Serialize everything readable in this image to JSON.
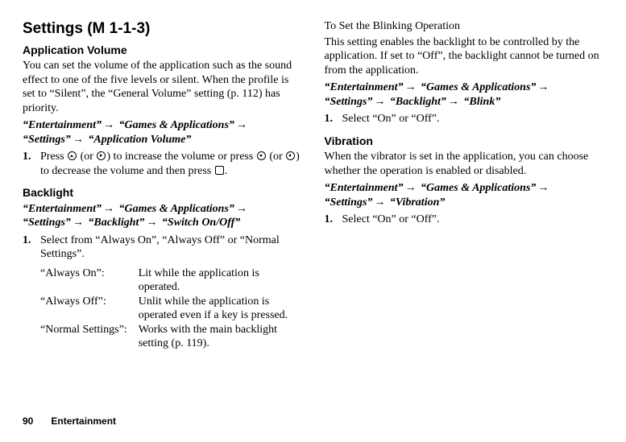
{
  "left": {
    "title": "Settings (M 1-1-3)",
    "appvol": {
      "heading": "Application Volume",
      "body": "You can set the volume of the application such as the sound effect to one of the five levels or silent. When the profile is set to “Silent”, the “General Volume” setting (p. 112) has priority.",
      "path": [
        "“Entertainment”",
        "“Games & Applications”",
        "“Settings”",
        "“Application Volume”"
      ],
      "step_num": "1.",
      "step_a": "Press ",
      "step_b": " (or ",
      "step_c": ") to increase the volume or press ",
      "step_d": " (or ",
      "step_e": ") to decrease the volume and then press ",
      "step_f": "."
    },
    "backlight": {
      "heading": "Backlight",
      "path": [
        "“Entertainment”",
        "“Games & Applications”",
        "“Settings”",
        "“Backlight”",
        "“Switch On/Off”"
      ],
      "step_num": "1.",
      "step_body": "Select from “Always On”, “Always Off” or “Normal Settings”.",
      "defs": [
        {
          "term": "“Always On”:",
          "desc": "Lit while the application is operated."
        },
        {
          "term": "“Always Off”:",
          "desc": "Unlit while the application is operated even if a key is pressed."
        },
        {
          "term": "“Normal Settings”:",
          "desc": "Works with the main backlight setting (p. 119)."
        }
      ]
    }
  },
  "right": {
    "blinking": {
      "heading": "To Set the Blinking Operation",
      "body": "This setting enables the backlight to be controlled by the application. If set to “Off”, the backlight cannot be turned on from the application.",
      "path": [
        "“Entertainment”",
        "“Games & Applications”",
        "“Settings”",
        "“Backlight”",
        "“Blink”"
      ],
      "step_num": "1.",
      "step_body": "Select “On” or “Off”."
    },
    "vibration": {
      "heading": "Vibration",
      "body": "When the vibrator is set in the application, you can choose whether the operation is enabled or disabled.",
      "path": [
        "“Entertainment”",
        "“Games & Applications”",
        "“Settings”",
        "“Vibration”"
      ],
      "step_num": "1.",
      "step_body": "Select “On” or “Off”."
    }
  },
  "footer": {
    "page": "90",
    "section": "Entertainment"
  },
  "arrow": "→"
}
